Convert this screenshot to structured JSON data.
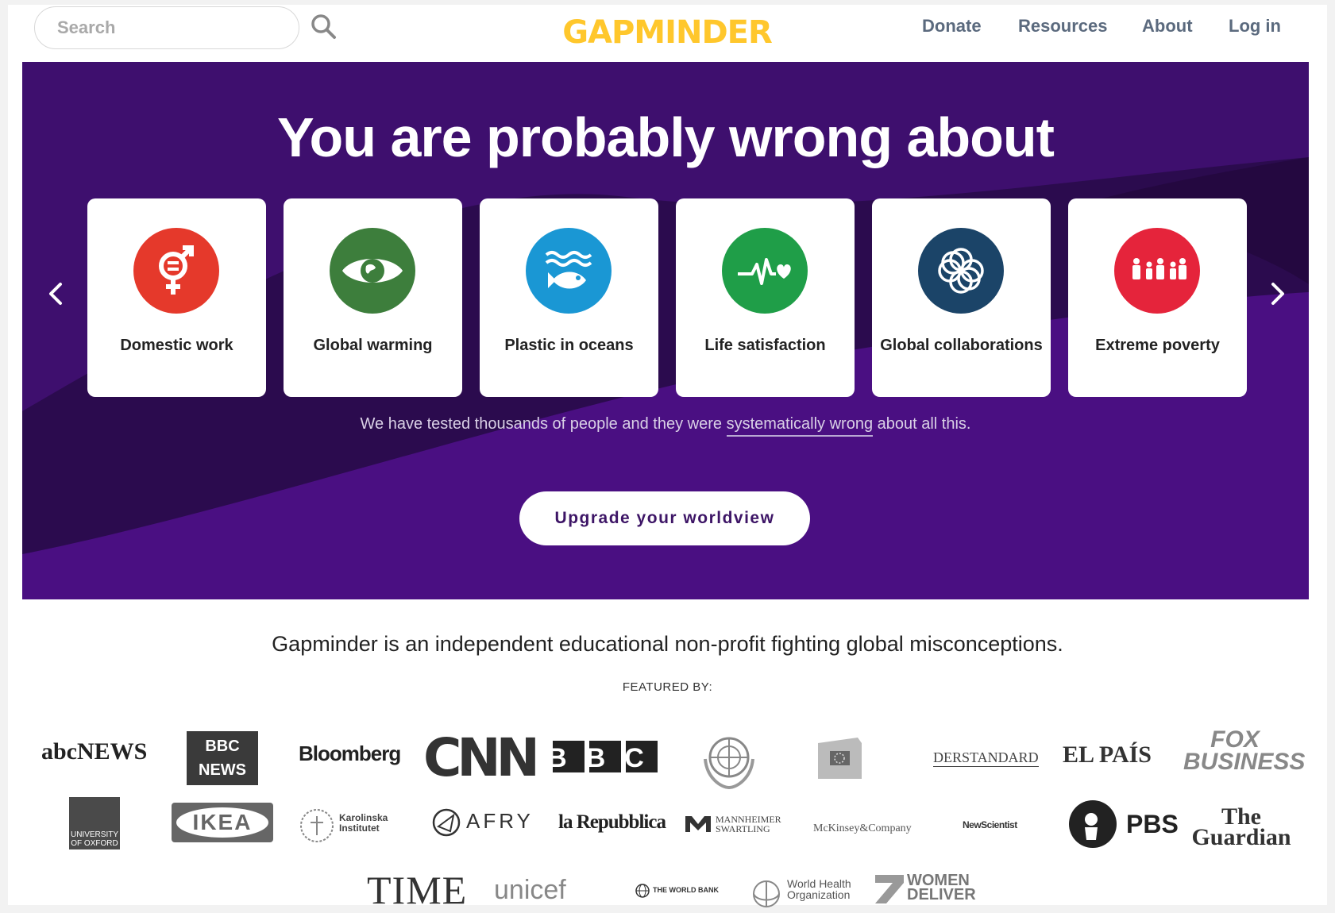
{
  "header": {
    "search_placeholder": "Search",
    "logo_text": "GAPMINDER",
    "nav": [
      "Donate",
      "Resources",
      "About",
      "Log in"
    ]
  },
  "hero": {
    "title": "You are probably wrong about",
    "cards": [
      {
        "label": "Domestic work",
        "color": "#e5392b"
      },
      {
        "label": "Global warming",
        "color": "#3d7e3c"
      },
      {
        "label": "Plastic in oceans",
        "color": "#1a97d4"
      },
      {
        "label": "Life satisfaction",
        "color": "#1f9e48"
      },
      {
        "label": "Global collaborations",
        "color": "#1b4468"
      },
      {
        "label": "Extreme poverty",
        "color": "#e5243b"
      }
    ],
    "tested_prefix": "We have tested thousands of people and they were ",
    "tested_link": "systematically wrong",
    "tested_suffix": " about all this.",
    "cta": "Upgrade your worldview"
  },
  "mission": "Gapminder is an independent educational non-profit fighting global misconceptions.",
  "featured_label": "FEATURED BY:",
  "logos": {
    "row1": [
      "abcNEWS",
      "BBC NEWS",
      "Bloomberg",
      "CNN",
      "BBC",
      "United Nations",
      "European Commission",
      "DERSTANDARD",
      "EL PAÍS",
      "FOX BUSINESS"
    ],
    "row2": [
      "UNIVERSITY OF OXFORD",
      "IKEA",
      "Karolinska Institutet",
      "AFRY",
      "la Repubblica",
      "MANNHEIMER SWARTLING",
      "McKinsey&Company",
      "NewScientist",
      "PBS",
      "The Guardian"
    ],
    "row3": [
      "TIME",
      "unicef",
      "THE WORLD BANK",
      "World Health Organization",
      "WOMEN DELIVER"
    ]
  }
}
